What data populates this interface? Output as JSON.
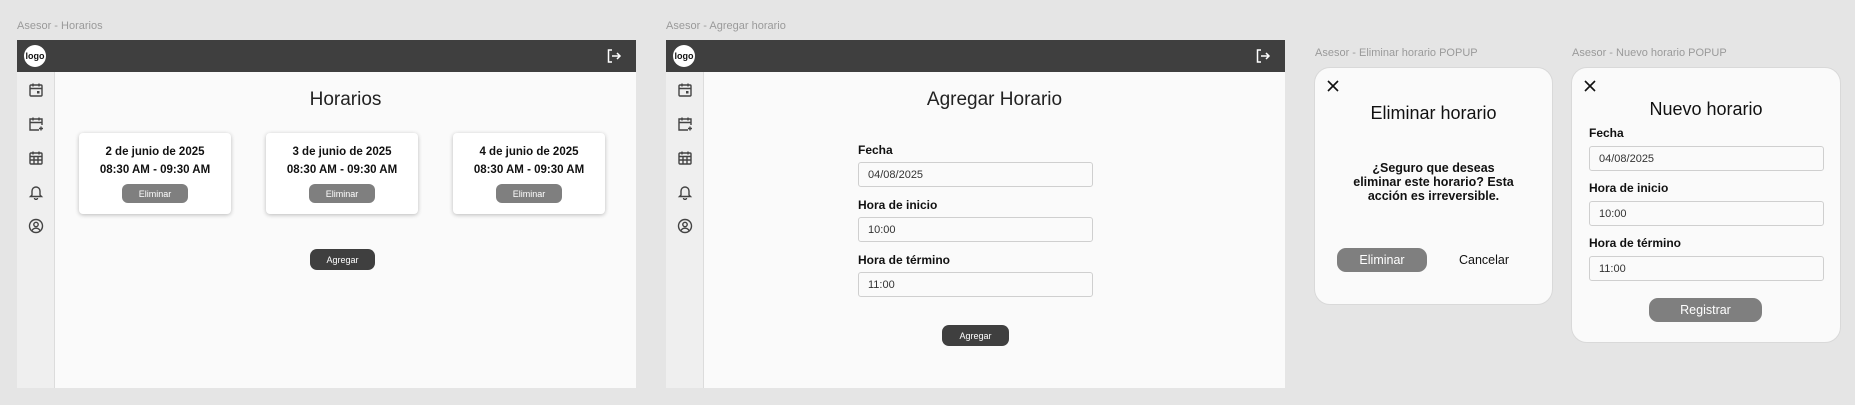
{
  "frames": {
    "horarios": {
      "label": "Asesor - Horarios",
      "logo": "logo",
      "title": "Horarios",
      "cards": [
        {
          "date": "2 de junio de 2025",
          "time": "08:30 AM - 09:30 AM",
          "button": "Eliminar"
        },
        {
          "date": "3 de junio de 2025",
          "time": "08:30 AM - 09:30 AM",
          "button": "Eliminar"
        },
        {
          "date": "4 de junio de 2025",
          "time": "08:30 AM - 09:30 AM",
          "button": "Eliminar"
        }
      ],
      "add_button": "Agregar"
    },
    "agregar": {
      "label": "Asesor - Agregar horario",
      "logo": "logo",
      "title": "Agregar Horario",
      "fields": [
        {
          "label": "Fecha",
          "value": "04/08/2025"
        },
        {
          "label": "Hora de inicio",
          "value": "10:00"
        },
        {
          "label": "Hora de término",
          "value": "11:00"
        }
      ],
      "add_button": "Agregar"
    },
    "eliminar_popup": {
      "label": "Asesor - Eliminar horario POPUP",
      "title": "Eliminar horario",
      "message": [
        "¿Seguro que deseas",
        "eliminar este horario? Esta",
        "acción es irreversible."
      ],
      "confirm_button": "Eliminar",
      "cancel_button": "Cancelar"
    },
    "nuevo_popup": {
      "label": "Asesor - Nuevo horario POPUP",
      "title": "Nuevo horario",
      "fields": [
        {
          "label": "Fecha",
          "value": "04/08/2025"
        },
        {
          "label": "Hora de inicio",
          "value": "10:00"
        },
        {
          "label": "Hora de término",
          "value": "11:00"
        }
      ],
      "submit_button": "Registrar"
    }
  },
  "icons": {
    "logout": "logout-icon",
    "sidebar": [
      "calendar-icon",
      "calendar-add-icon",
      "calendar-grid-icon",
      "bell-icon",
      "user-circle-icon"
    ],
    "close": "close-icon"
  },
  "colors": {
    "background": "#e5e5e5",
    "topbar": "#3f3f3f",
    "surface": "#fafafa",
    "grey_button": "#7f7f7f",
    "dark_button": "#3f3f3f"
  }
}
